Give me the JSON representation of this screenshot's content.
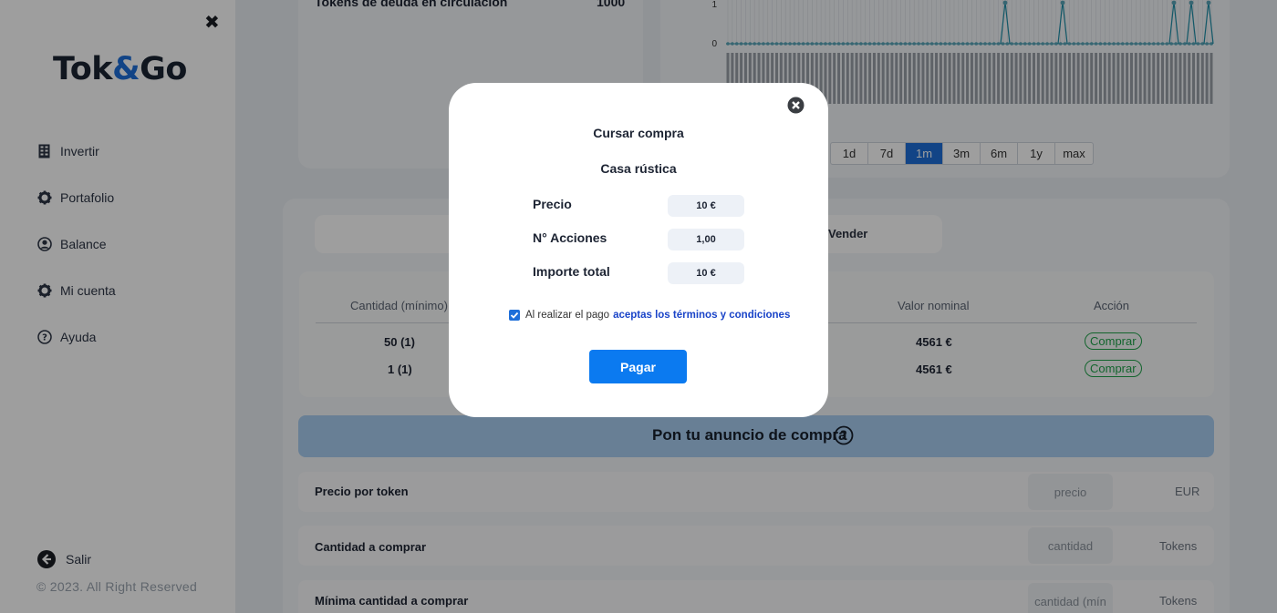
{
  "app": {
    "logo_part1": "Tok",
    "logo_amp": "&",
    "logo_part2": "Go",
    "accent": "#1e6fd9"
  },
  "sidebar": {
    "items": [
      {
        "label": "Invertir",
        "icon": "building-icon"
      },
      {
        "label": "Portafolio",
        "icon": "gear-icon"
      },
      {
        "label": "Balance",
        "icon": "user-circle-icon"
      },
      {
        "label": "Mi cuenta",
        "icon": "gear-icon"
      },
      {
        "label": "Ayuda",
        "icon": "question-circle-icon"
      }
    ],
    "logout": "Salir",
    "copyright": "© 2023. All Right Reserved"
  },
  "top": {
    "tokens_label": "Tokens de deuda en circulación",
    "tokens_value": "1000"
  },
  "chart": {
    "y_ticks": [
      "1",
      "0"
    ]
  },
  "range": {
    "options": [
      "1d",
      "7d",
      "1m",
      "3m",
      "6m",
      "1y",
      "max"
    ],
    "selected": "1m"
  },
  "trade": {
    "tab_sell": "Vender",
    "columns": [
      "Cantidad (mínimo)",
      "Valor nominal",
      "Acción"
    ],
    "rows": [
      {
        "cantidad": "50 (1)",
        "valor": "4561 €",
        "accion": "Comprar"
      },
      {
        "cantidad": "1 (1)",
        "valor": "4561 €",
        "accion": "Comprar"
      }
    ]
  },
  "announce": {
    "title": "Pon tu anuncio de compra",
    "rows": [
      {
        "label": "Precio por token",
        "placeholder": "precio",
        "unit": "EUR"
      },
      {
        "label": "Cantidad a comprar",
        "placeholder": "cantidad",
        "unit": "Tokens"
      },
      {
        "label": "Mínima cantidad a comprar",
        "placeholder": "cantidad (mín",
        "unit": "Tokens"
      }
    ]
  },
  "modal": {
    "title": "Cursar compra",
    "subtitle": "Casa rústica",
    "fields": [
      {
        "label": "Precio",
        "value": "10 €"
      },
      {
        "label": "N° Acciones",
        "value": "1,00"
      },
      {
        "label": "Importe total",
        "value": "10 €"
      }
    ],
    "terms_text": "Al realizar el pago",
    "terms_link": "aceptas los términos y condiciones",
    "terms_checked": true,
    "pay_label": "Pagar"
  }
}
